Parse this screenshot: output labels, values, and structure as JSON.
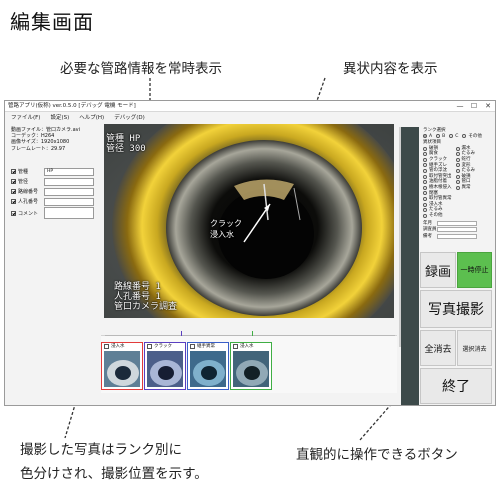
{
  "header": {
    "title": "編集画面"
  },
  "annotations": {
    "top_left": "必要な管路情報を常時表示",
    "top_right": "異状内容を表示",
    "bottom_left_line1": "撮影した写真はランク別に",
    "bottom_left_line2": "色分けされ、撮影位置を示す。",
    "bottom_right": "直観的に操作できるボタン"
  },
  "window": {
    "title": "管路アプリ(仮称) ver.0.5.0 [デバッグ 電機 モード]",
    "controls": [
      "—",
      "☐",
      "✕"
    ],
    "menu": [
      "ファイル(F)",
      "設定(S)",
      "ヘルプ(H)",
      "デバッグ(D)"
    ]
  },
  "file_info": [
    "動画ファイル：管口カメラ.avi",
    "コーデック：H264",
    "画像サイズ：1920x1080",
    "フレームレート：29.97"
  ],
  "fields": [
    {
      "label": "管種",
      "value": "HP",
      "checked": true
    },
    {
      "label": "管径",
      "value": "",
      "checked": true
    },
    {
      "label": "路線番号",
      "value": "",
      "checked": true
    },
    {
      "label": "人孔番号",
      "value": "",
      "checked": true
    },
    {
      "label": "コメント",
      "value": "",
      "checked": true
    }
  ],
  "video_overlay": {
    "top_line1": "管種 HP",
    "top_line2": "管径 300",
    "bubble_line1": "クラック",
    "bubble_line2": "浸入水",
    "bottom_line1": "路線番号 1",
    "bottom_line2": "人孔番号 1",
    "bottom_line3": "管口カメラ調査"
  },
  "thumbnails": [
    {
      "label": "浸入水",
      "color": "#e23b3b"
    },
    {
      "label": "クラック",
      "color": "#5a3fc0"
    },
    {
      "label": "継手異常",
      "color": "#3a5fc8"
    },
    {
      "label": "浸入水",
      "color": "#3fae44"
    }
  ],
  "rank_panel": {
    "section_title": "ランク選択",
    "ranks": [
      "A",
      "B",
      "C",
      "その他"
    ],
    "damage_title": "異状項目",
    "damage_left": [
      "破損",
      "腐食",
      "クラック",
      "継手ズレ",
      "管の浮沈",
      "取付管突出",
      "油脂付着",
      "樹木根侵入",
      "閉塞",
      "取付管異常",
      "浸入水",
      "たるみ",
      "その他"
    ],
    "damage_right": [
      "漏水",
      "たるみ",
      "蛇行",
      "変形",
      "たるみ",
      "破損",
      "管口",
      "異常"
    ],
    "date_label": "年月",
    "user_label": "調査員",
    "note_label": "備考"
  },
  "buttons": {
    "record": "録画",
    "pause": "一時停止",
    "photo": "写真撮影",
    "clear_all": "全消去",
    "clear_selected": "選択消去",
    "exit": "終了"
  },
  "colors": {
    "pause_green": "#5cbf4f",
    "dark_bar": "#3d4a4a",
    "button_gray": "#e9e9e9"
  }
}
